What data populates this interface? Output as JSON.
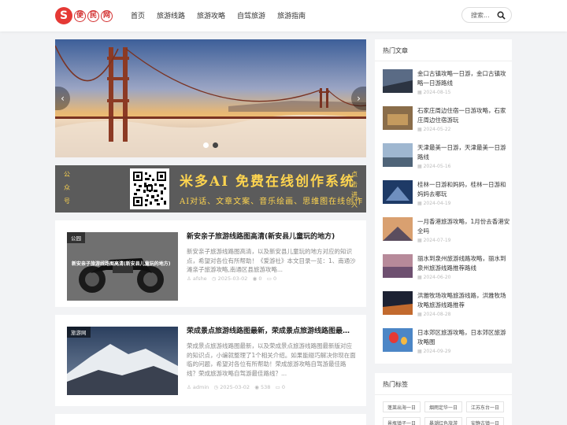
{
  "brand": {
    "logo_char": "S",
    "c1": "便",
    "c2": "民",
    "c3": "网"
  },
  "nav": [
    "首页",
    "旅游线路",
    "旅游攻略",
    "自驾旅游",
    "旅游指南"
  ],
  "search": {
    "placeholder": "搜索..."
  },
  "slider": {
    "prev": "‹",
    "next": "›",
    "active_dot": 1,
    "dot_count": 2
  },
  "banner": {
    "left_vertical": [
      "公",
      "众",
      "号"
    ],
    "right_vertical": [
      "点",
      "击",
      "进",
      "入"
    ],
    "headline": "米多AI 免费在线创作系统",
    "subline": "AI对话、文章文案、音乐绘画、思维图在线创作"
  },
  "posts": [
    {
      "category": "公园",
      "thumb_caption": "新安亲子旅游线路图高清(新安县儿童玩的地方)",
      "title": "新安亲子旅游线路图高清(新安县儿童玩的地方)",
      "excerpt": "新安亲子旅游线路图高清，以及新安县儿童玩的地方对应的知识点，希望对各位有所帮助！《爱游社》本文目录一览：1、南通沙滩亲子旅游攻略,南通区县旅游攻略...",
      "author": "afshe",
      "date": "2025-03-02",
      "views": "0",
      "comments": "0"
    },
    {
      "category": "旅游网",
      "title": "荣成景点旅游线路图最新，荣成景点旅游线路图最新版",
      "excerpt": "荣成景点旅游线路图最新，以及荣成景点旅游线路图最新版对应的知识点，小编就整理了1个相关介绍。如果能碰巧解决你现在面临的问题，希望对各位有所帮助！荣成旅游攻略自驾游最佳路线？荣成旅游攻略自驾游最佳路线？...",
      "author": "admin",
      "date": "2025-03-02",
      "views": "538",
      "comments": "0"
    }
  ],
  "hot": {
    "title": "热门文章",
    "items": [
      {
        "title": "金口古镇攻略一日游，金口古镇攻略一日游路线",
        "date": "2024-08-15"
      },
      {
        "title": "石家庄周边住宿一日游攻略，石家庄周边住宿游玩",
        "date": "2024-05-22"
      },
      {
        "title": "天津最美一日游，天津最美一日游路线",
        "date": "2024-05-16"
      },
      {
        "title": "桂林一日游和妈妈，桂林一日游和妈妈去哪玩",
        "date": "2024-04-19"
      },
      {
        "title": "一月香港旅游攻略，1月份去香港安全吗",
        "date": "2024-07-19"
      },
      {
        "title": "丽水到泉州旅游线路攻略，丽水到泉州旅游线路推荐路线",
        "date": "2024-06-20"
      },
      {
        "title": "洪雅牧场攻略旅游线路，洪雅牧场攻略旅游线路推荐",
        "date": "2024-08-28"
      },
      {
        "title": "日本郊区旅游攻略，日本郊区旅游攻略图",
        "date": "2024-09-29"
      }
    ]
  },
  "tags": {
    "title": "热门标签",
    "items": [
      "蓬莱出海一日",
      "烟雨定华一日",
      "江苏东台一日",
      "景瓶镇子一日",
      "暴潮红色旅游",
      "安静古镇一日"
    ]
  },
  "colors": {
    "brand_red": "#e53935",
    "banner_yellow": "#ffd54f",
    "page_bg": "#f2f3f5"
  }
}
